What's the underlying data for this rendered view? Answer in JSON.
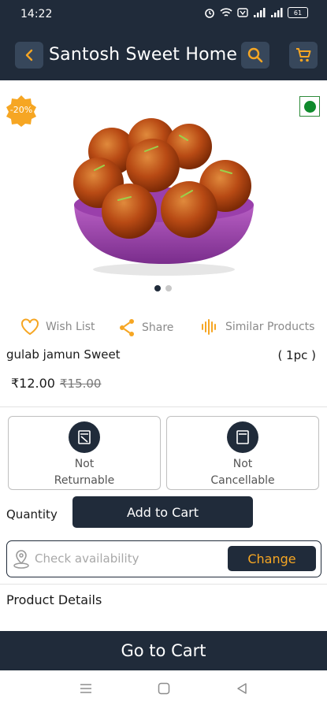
{
  "status_bar": {
    "time": "14:22",
    "battery": "61"
  },
  "header": {
    "title": "Santosh Sweet Home"
  },
  "product": {
    "discount_badge": "-20%",
    "name": "gulab jamun Sweet",
    "pack": "( 1pc )",
    "price": "₹12.00",
    "mrp": "₹15.00",
    "image_pages": 2,
    "current_image": 1,
    "veg": true
  },
  "actions": {
    "wishlist": "Wish List",
    "share": "Share",
    "similar": "Similar Products"
  },
  "policies": [
    {
      "line1": "Not",
      "line2": "Returnable"
    },
    {
      "line1": "Not",
      "line2": "Cancellable"
    }
  ],
  "quantity": {
    "label": "Quantity",
    "add_button": "Add to Cart"
  },
  "availability": {
    "placeholder": "Check availability",
    "change_button": "Change"
  },
  "details": {
    "heading": "Product Details"
  },
  "footer": {
    "go_to_cart": "Go to Cart"
  },
  "colors": {
    "primary": "#202b3a",
    "accent": "#f6a623",
    "veg": "#0f8a2c"
  },
  "icons": [
    "back-icon",
    "search-icon",
    "cart-icon",
    "heart-icon",
    "share-icon",
    "similar-icon",
    "location-pin-icon"
  ]
}
